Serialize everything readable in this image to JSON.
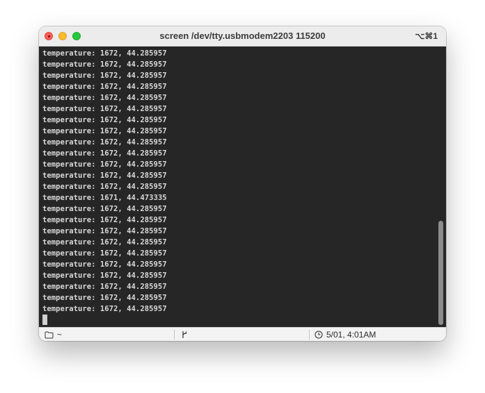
{
  "window": {
    "title": "screen /dev/tty.usbmodem2203 115200",
    "shortcut": "⌥⌘1"
  },
  "terminal": {
    "lines": [
      "temperature: 1672, 44.285957",
      "temperature: 1672, 44.285957",
      "temperature: 1672, 44.285957",
      "temperature: 1672, 44.285957",
      "temperature: 1672, 44.285957",
      "temperature: 1672, 44.285957",
      "temperature: 1672, 44.285957",
      "temperature: 1672, 44.285957",
      "temperature: 1672, 44.285957",
      "temperature: 1672, 44.285957",
      "temperature: 1672, 44.285957",
      "temperature: 1672, 44.285957",
      "temperature: 1672, 44.285957",
      "temperature: 1671, 44.473335",
      "temperature: 1672, 44.285957",
      "temperature: 1672, 44.285957",
      "temperature: 1672, 44.285957",
      "temperature: 1672, 44.285957",
      "temperature: 1672, 44.285957",
      "temperature: 1672, 44.285957",
      "temperature: 1672, 44.285957",
      "temperature: 1672, 44.285957",
      "temperature: 1672, 44.285957",
      "temperature: 1672, 44.285957"
    ],
    "background_color": "#262626",
    "text_color": "#d8d8d8"
  },
  "statusbar": {
    "directory": "~",
    "directory_icon": "folder-icon",
    "git_icon": "git-branch-icon",
    "time_icon": "clock-icon",
    "time": "5/01, 4:01AM"
  }
}
